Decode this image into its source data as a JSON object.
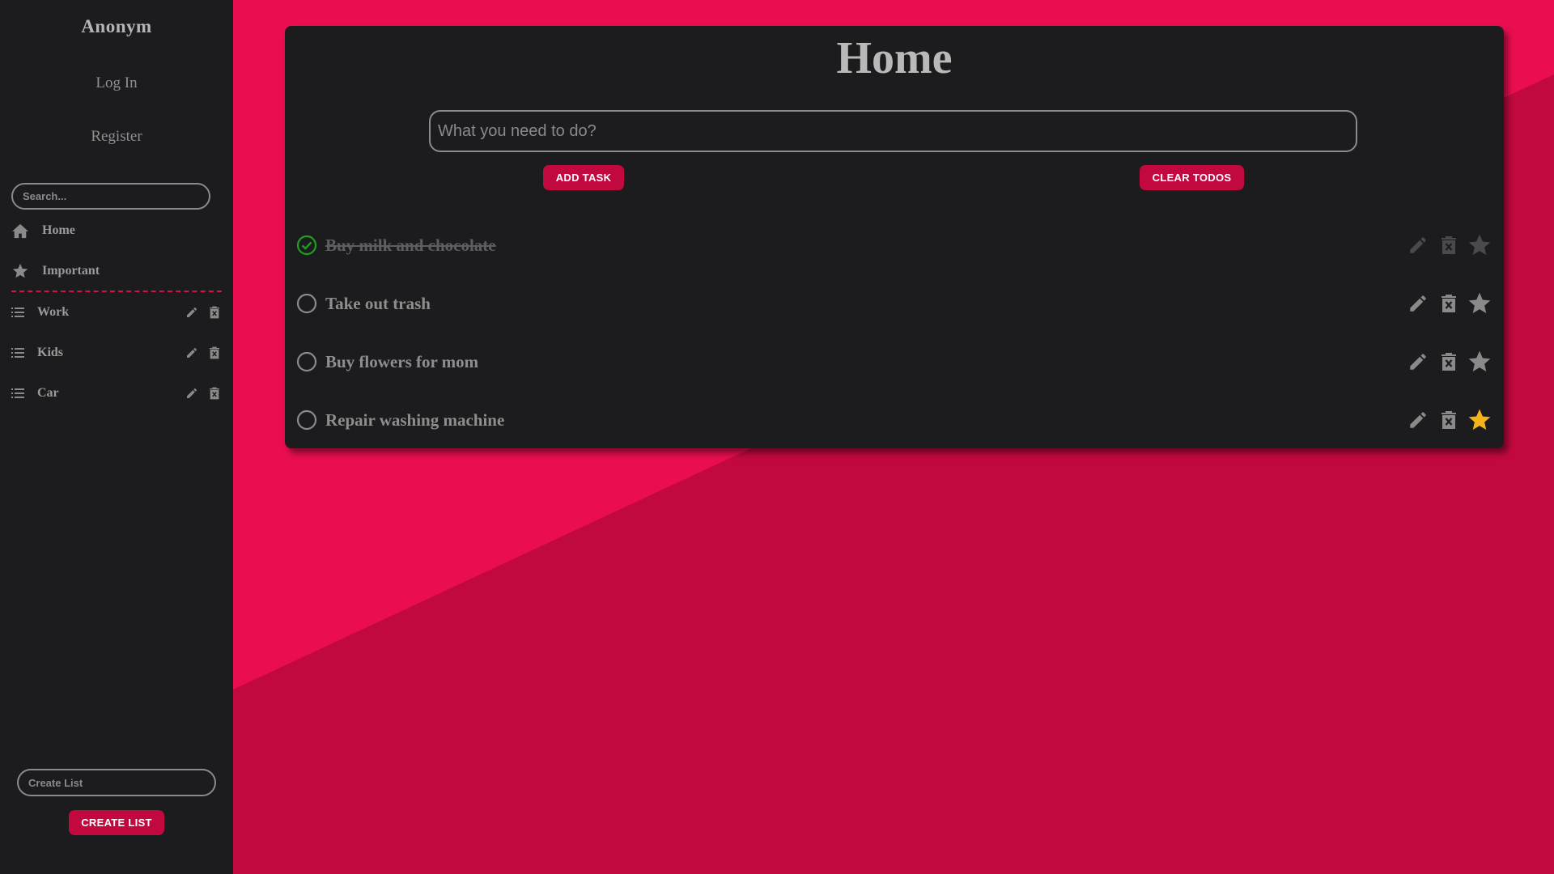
{
  "sidebar": {
    "user_name": "Anonym",
    "login_label": "Log In",
    "register_label": "Register",
    "search_placeholder": "Search...",
    "nav": [
      {
        "label": "Home",
        "icon": "home-icon"
      },
      {
        "label": "Important",
        "icon": "star-icon"
      }
    ],
    "lists": [
      {
        "label": "Work",
        "icon": "list-icon"
      },
      {
        "label": "Kids",
        "icon": "list-icon"
      },
      {
        "label": "Car",
        "icon": "list-icon"
      }
    ],
    "create_list_placeholder": "Create List",
    "create_list_button": "Create List"
  },
  "main": {
    "title": "Home",
    "task_input_placeholder": "What you need to do?",
    "add_task_button": "Add Task",
    "clear_todos_button": "Clear Todos",
    "todos": [
      {
        "text": "Buy milk and chocolate",
        "completed": true,
        "important": false
      },
      {
        "text": "Take out trash",
        "completed": false,
        "important": false
      },
      {
        "text": "Buy flowers for mom",
        "completed": false,
        "important": false
      },
      {
        "text": "Repair washing machine",
        "completed": false,
        "important": true
      }
    ]
  },
  "colors": {
    "accent": "#c2093f",
    "background_light": "#ea0e50",
    "panel": "#1c1c1e",
    "text_muted": "#8e8e8e",
    "completed_check": "#1f9e1f",
    "star_active": "#f5b31b",
    "star_inactive": "#8a8a8a"
  }
}
